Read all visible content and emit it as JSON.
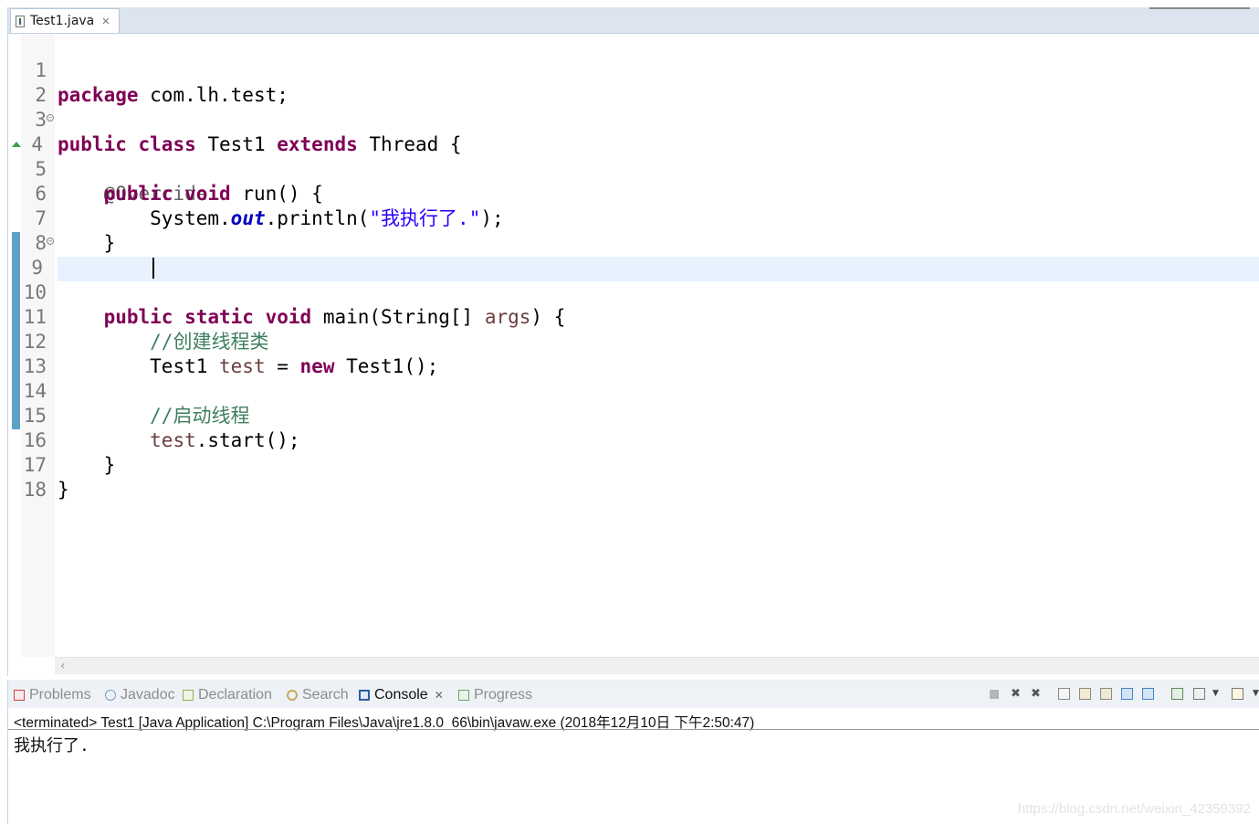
{
  "editor": {
    "tab_title": "Test1.java",
    "lines": [
      {
        "n": "1"
      },
      {
        "n": "2"
      },
      {
        "n": "3"
      },
      {
        "n": "4"
      },
      {
        "n": "5"
      },
      {
        "n": "6"
      },
      {
        "n": "7"
      },
      {
        "n": "8"
      },
      {
        "n": "9"
      },
      {
        "n": "10"
      },
      {
        "n": "11"
      },
      {
        "n": "12"
      },
      {
        "n": "13"
      },
      {
        "n": "14"
      },
      {
        "n": "15"
      },
      {
        "n": "16"
      },
      {
        "n": "17"
      },
      {
        "n": "18"
      }
    ],
    "code": {
      "l1_kw": "package",
      "l1_rest": " com.lh.test;",
      "l3_kw1": "public",
      "l3_kw2": "class",
      "l3_name": " Test1 ",
      "l3_kw3": "extends",
      "l3_rest": " Thread {",
      "l4_ann": "@Override",
      "l5_kw1": "public",
      "l5_kw2": "void",
      "l5_rest": " run() {",
      "l6_a": "System.",
      "l6_field": "out",
      "l6_b": ".println(",
      "l6_str": "\"我执行了.\"",
      "l6_c": ");",
      "l7": "}",
      "l9_kw1": "public",
      "l9_kw2": "static",
      "l9_kw3": "void",
      "l9_a": " main(String[] ",
      "l9_param": "args",
      "l9_b": ") {",
      "l11_cmt": "//创建线程类",
      "l12_a": "Test1 ",
      "l12_var": "test",
      "l12_b": " = ",
      "l12_kw": "new",
      "l12_c": " Test1();",
      "l14_cmt": "//启动线程",
      "l15_var": "test",
      "l15_rest": ".start();",
      "l16": "}",
      "l17": "}"
    }
  },
  "panel": {
    "tabs": {
      "problems": "Problems",
      "javadoc": "Javadoc",
      "declaration": "Declaration",
      "search": "Search",
      "console": "Console",
      "progress": "Progress"
    },
    "console_header": "<terminated> Test1 [Java Application] C:\\Program Files\\Java\\jre1.8.0_66\\bin\\javaw.exe (2018年12月10日 下午2:50:47)",
    "console_output": "我执行了."
  },
  "watermark": "https://blog.csdn.net/weixin_42359392"
}
